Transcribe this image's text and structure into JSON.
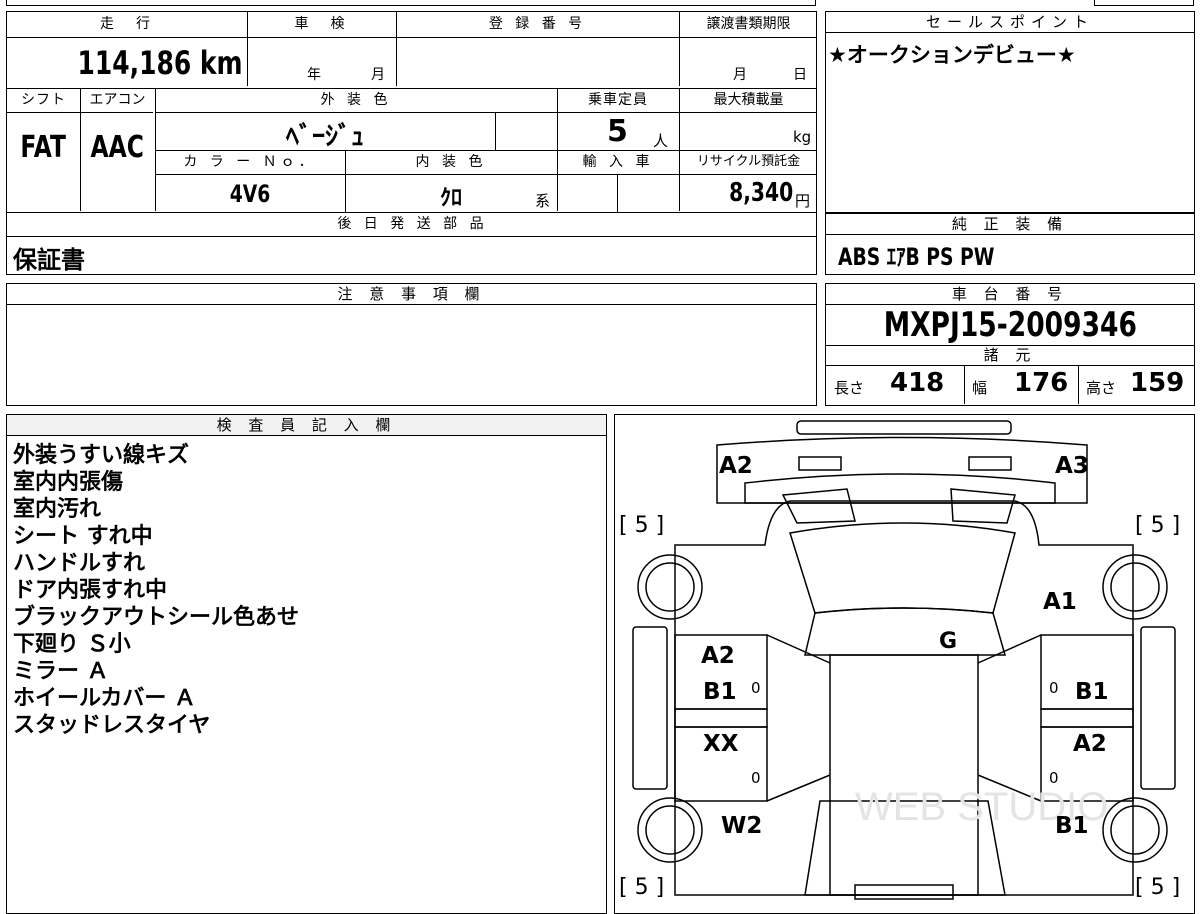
{
  "top_sheet": {
    "mileage": {
      "label": "走　行",
      "value": "114,186 km"
    },
    "inspection": {
      "label": "車　検",
      "year": "年",
      "month": "月"
    },
    "registration": {
      "label": "登 録 番 号",
      "value": ""
    },
    "transfer_deadline": {
      "label": "譲渡書類期限",
      "month": "月",
      "day": "日"
    },
    "shift": {
      "label": "シフト",
      "value": "FAT"
    },
    "aircon": {
      "label": "エアコン",
      "value": "AAC"
    },
    "exterior_color": {
      "label": "外 装 色",
      "value": "ﾍﾞｰｼﾞｭ"
    },
    "capacity": {
      "label": "乗車定員",
      "value": "5",
      "unit": "人"
    },
    "max_load": {
      "label": "最大積載量",
      "value": "",
      "unit": "kg"
    },
    "color_no": {
      "label": "カ ラ ー Ｎｏ．",
      "value": "4V6"
    },
    "interior_color": {
      "label": "内 装 色",
      "value": "ｸﾛ",
      "suffix": "系"
    },
    "import": {
      "label": "輸 入 車",
      "value": ""
    },
    "recycle_fee": {
      "label": "リサイクル預託金",
      "value": "8,340",
      "unit": "円"
    },
    "later_parts": {
      "label": "後 日 発 送 部 品",
      "value": "保証書"
    }
  },
  "sales_point": {
    "label": "セールスポイント",
    "value": "★オークションデビュー★"
  },
  "genuine_equipment": {
    "label": "純 正 装 備",
    "value": "ABS ｴｱB PS PW"
  },
  "notes": {
    "label": "注 意 事 項 欄",
    "value": ""
  },
  "chassis": {
    "label": "車 台 番 号",
    "value": "MXPJ15-2009346"
  },
  "specs": {
    "label": "諸 元",
    "length_label": "長さ",
    "length": "418",
    "width_label": "幅",
    "width": "176",
    "height_label": "高さ",
    "height": "159"
  },
  "inspector": {
    "label": "検 査 員 記 入 欄",
    "remarks": [
      "外装うすい線キズ",
      "室内内張傷",
      "室内汚れ",
      "シート すれ中",
      "ハンドルすれ",
      "ドア内張すれ中",
      "ブラックアウトシール色あせ",
      "下廻り Ｓ小",
      "ミラー Ａ",
      "ホイールカバー Ａ",
      "スタッドレスタイヤ"
    ]
  },
  "diagram": {
    "tire_fl": "[ 5 ]",
    "tire_fr": "[ 5 ]",
    "tire_rl": "[ 5 ]",
    "tire_rr": "[ 5 ]",
    "front_left": "A2",
    "front_right": "A3",
    "fender_right": "A1",
    "windshield": "G",
    "front_door_left_1": "A2",
    "front_door_left_2": "B1",
    "front_door_left_zero": "0",
    "front_door_right": "B1",
    "front_door_right_zero": "0",
    "rear_door_left": "XX",
    "rear_door_left_zero": "0",
    "rear_door_right": "A2",
    "rear_door_right_zero": "0",
    "rear_fender_left": "W2",
    "rear_fender_right": "B1",
    "watermark": "WEB STUDIO"
  }
}
